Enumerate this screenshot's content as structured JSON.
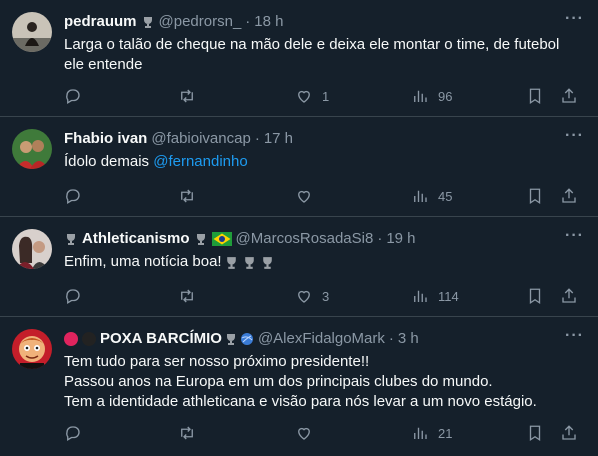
{
  "tweets": [
    {
      "name": "pedrauum",
      "handle": "@pedrorsn_",
      "time": "18 h",
      "text_lines": [
        "Larga o talão de cheque na mão dele e deixa ele montar o time, de futebol ele entende"
      ],
      "replies": "",
      "retweets": "",
      "likes": "1",
      "views": "96"
    },
    {
      "name": "Fhabio ivan",
      "handle": "@fabioivancap",
      "time": "17 h",
      "text_prefix": "Ídolo demais ",
      "mention": "@fernandinho",
      "replies": "",
      "retweets": "",
      "likes": "",
      "views": "45"
    },
    {
      "name": "Athleticanismo",
      "handle": "@MarcosRosadaSi8",
      "time": "19 h",
      "text_lines": [
        "Enfim, uma notícia boa!"
      ],
      "replies": "",
      "retweets": "",
      "likes": "3",
      "views": "114"
    },
    {
      "name": "POXA BARCÍMIO",
      "handle": "@AlexFidalgoMark",
      "time": "3 h",
      "text_lines": [
        "Tem tudo para ser nosso próximo presidente!!",
        "Passou anos na Europa em um dos principais clubes do mundo.",
        "Tem a identidade athleticana e visão para nós levar a um novo estágio."
      ],
      "replies": "",
      "retweets": "",
      "likes": "",
      "views": "21"
    }
  ],
  "separator": "·",
  "more_glyph": "···",
  "icons": [
    "reply-icon",
    "retweet-icon",
    "like-icon",
    "views-icon",
    "bookmark-icon",
    "share-icon",
    "trophy-icon",
    "brazil-flag-icon"
  ],
  "colors": {
    "background": "#15202b",
    "text": "#f7f9f9",
    "muted": "#8b98a5",
    "link": "#1d9bf0",
    "border": "#38444d"
  }
}
